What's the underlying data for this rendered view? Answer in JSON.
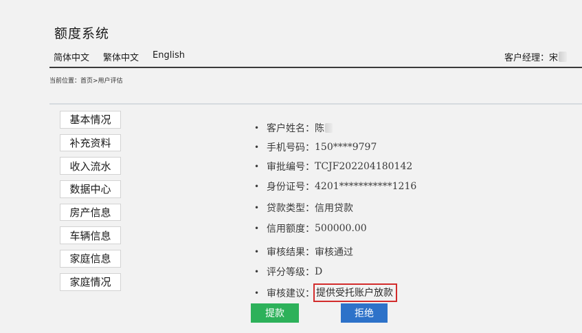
{
  "header": {
    "app_title": "额度系统",
    "languages": [
      "简体中文",
      "繁体中文",
      "English"
    ],
    "manager_label": "客户经理：宋"
  },
  "breadcrumb": "当前位置：首页>用户评估",
  "sidebar": {
    "items": [
      {
        "label": "基本情况"
      },
      {
        "label": "补充资料"
      },
      {
        "label": "收入流水"
      },
      {
        "label": "数据中心"
      },
      {
        "label": "房产信息"
      },
      {
        "label": "车辆信息"
      },
      {
        "label": "家庭信息"
      },
      {
        "label": "家庭情况"
      }
    ]
  },
  "customer": {
    "bullet": "•",
    "name_label": "客户姓名：",
    "name_value": "陈",
    "phone_label": "手机号码：",
    "phone_value": "150****9797",
    "approval_no_label": "审批编号：",
    "approval_no_value": "TCJF202204180142",
    "id_label": "身份证号：",
    "id_value": "4201***********1216",
    "loan_type_label": "贷款类型：",
    "loan_type_value": "信用贷款",
    "credit_limit_label": "信用额度：",
    "credit_limit_value": "500000.00",
    "review_result_label": "审核结果：",
    "review_result_value": "审核通过",
    "score_label": "评分等级：",
    "score_value": "D",
    "advice_label": "审核建议：",
    "advice_value": "提供受托账户放款"
  },
  "actions": {
    "withdraw_label": "提款",
    "reject_label": "拒绝"
  },
  "colors": {
    "withdraw_button": "#2db15a",
    "reject_button": "#2d72c9",
    "highlight_border": "#d22b2b"
  }
}
